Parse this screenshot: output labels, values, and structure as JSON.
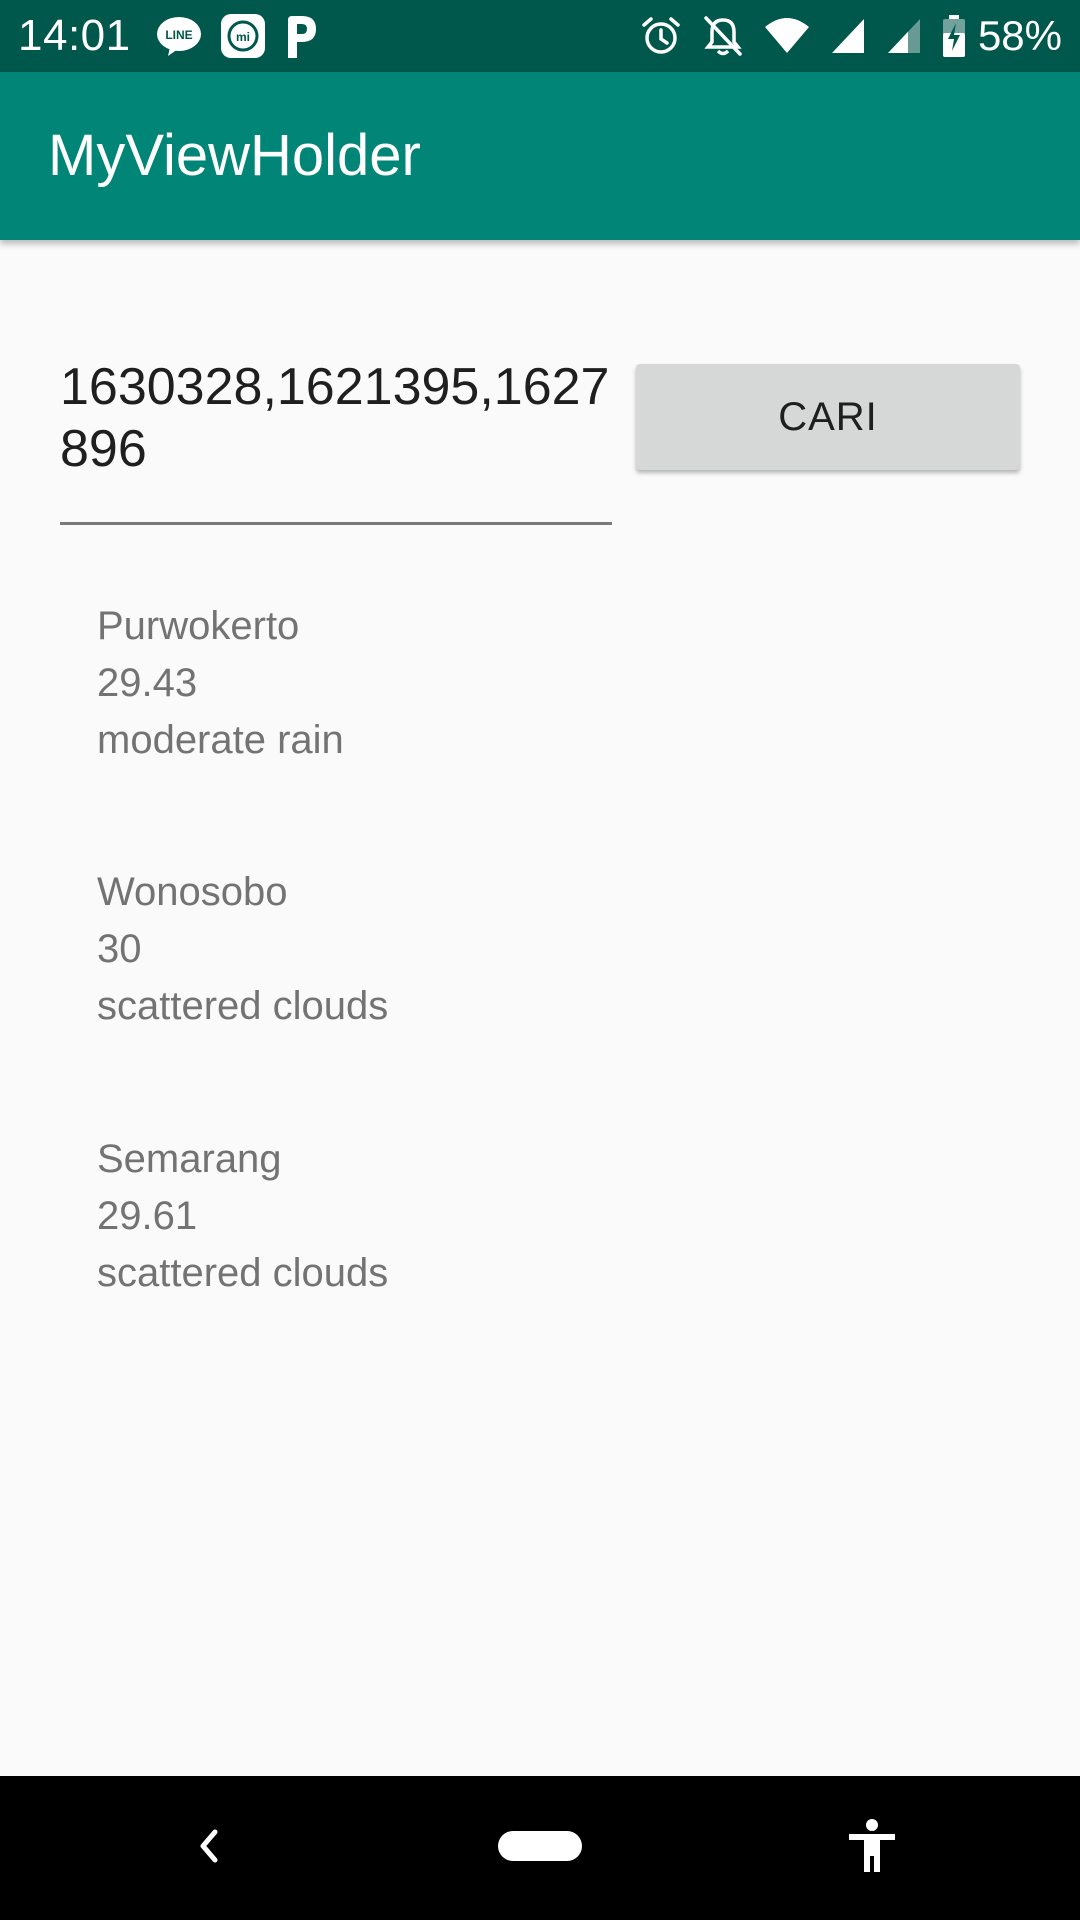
{
  "status_bar": {
    "time": "14:01",
    "notification_icons": [
      "line-app-icon",
      "mi-app-icon",
      "p-app-icon"
    ],
    "system_icons": [
      "alarm-icon",
      "notifications-off-icon",
      "wifi-icon",
      "signal-icon",
      "signal-icon-2",
      "battery-charging-icon"
    ],
    "battery_percent": "58%",
    "color": "#00574b"
  },
  "app_bar": {
    "title": "MyViewHolder",
    "color": "#008577"
  },
  "search": {
    "value": "1630328,1621395,1627896",
    "button_label": "CARI"
  },
  "weather": [
    {
      "city": "Purwokerto",
      "temp": "29.43",
      "desc": "moderate rain"
    },
    {
      "city": "Wonosobo",
      "temp": "30",
      "desc": "scattered clouds"
    },
    {
      "city": "Semarang",
      "temp": "29.61",
      "desc": "scattered clouds"
    }
  ],
  "nav_bar": {
    "icons": [
      "back-icon",
      "home-pill-icon",
      "accessibility-icon"
    ]
  }
}
